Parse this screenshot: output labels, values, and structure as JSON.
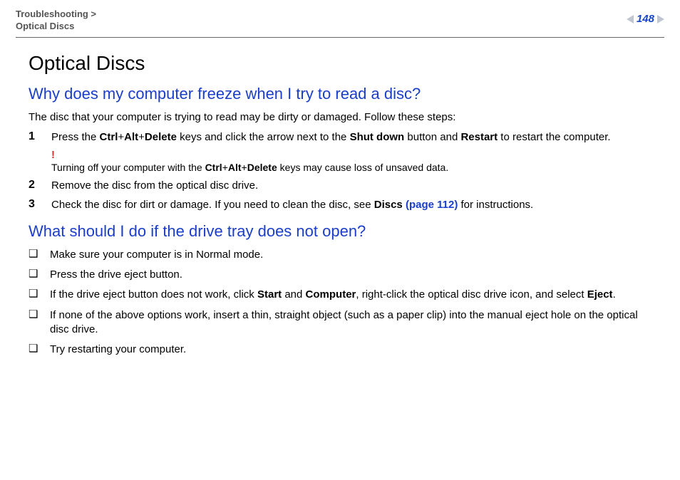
{
  "header": {
    "breadcrumb_line1": "Troubleshooting >",
    "breadcrumb_line2": "Optical Discs",
    "page_number": "148"
  },
  "section": {
    "title": "Optical Discs"
  },
  "q1": {
    "heading": "Why does my computer freeze when I try to read a disc?",
    "intro": "The disc that your computer is trying to read may be dirty or damaged. Follow these steps:",
    "steps": [
      {
        "num": "1",
        "pre": "Press the ",
        "k1": "Ctrl",
        "plus1": "+",
        "k2": "Alt",
        "plus2": "+",
        "k3": "Delete",
        "mid1": " keys and click the arrow next to the ",
        "b1": "Shut down",
        "mid2": " button and ",
        "b2": "Restart",
        "post": " to restart the computer.",
        "warn_mark": "!",
        "warn_pre": "Turning off your computer with the ",
        "warn_k1": "Ctrl",
        "warn_plus1": "+",
        "warn_k2": "Alt",
        "warn_plus2": "+",
        "warn_k3": "Delete",
        "warn_post": " keys may cause loss of unsaved data."
      },
      {
        "num": "2",
        "text": "Remove the disc from the optical disc drive."
      },
      {
        "num": "3",
        "pre": "Check the disc for dirt or damage. If you need to clean the disc, see ",
        "link_b": "Discs ",
        "link": "(page 112)",
        "post": " for instructions."
      }
    ]
  },
  "q2": {
    "heading": "What should I do if the drive tray does not open?",
    "bullets": [
      {
        "text": "Make sure your computer is in Normal mode."
      },
      {
        "text": "Press the drive eject button."
      },
      {
        "pre": "If the drive eject button does not work, click ",
        "b1": "Start",
        "mid1": " and ",
        "b2": "Computer",
        "mid2": ", right-click the optical disc drive icon, and select ",
        "b3": "Eject",
        "post": "."
      },
      {
        "text": "If none of the above options work, insert a thin, straight object (such as a paper clip) into the manual eject hole on the optical disc drive."
      },
      {
        "text": "Try restarting your computer."
      }
    ]
  }
}
